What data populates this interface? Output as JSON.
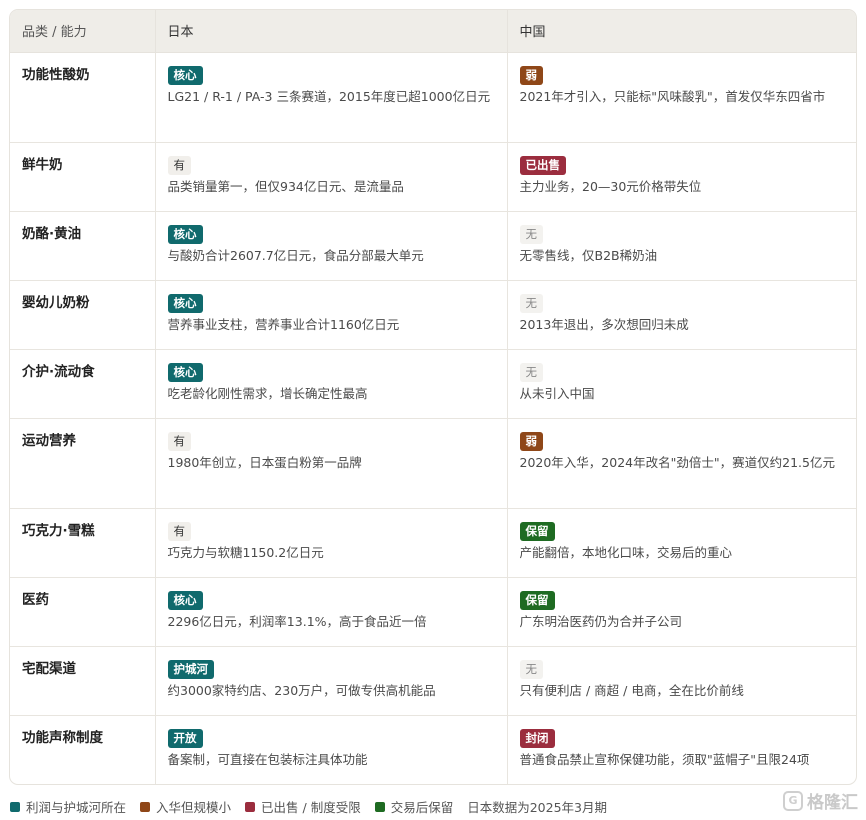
{
  "header": {
    "col1": "品类 / 能力",
    "col2": "日本",
    "col3": "中国"
  },
  "colors": {
    "teal": "#106a6d",
    "brown": "#8f4718",
    "red": "#9b2d3e",
    "green": "#1e6b22"
  },
  "rows": [
    {
      "category": "功能性酸奶",
      "jp": {
        "badge": "核心",
        "style": "teal",
        "text": "LG21 / R-1 / PA-3 三条赛道，2015年度已超1000亿日元"
      },
      "cn": {
        "badge": "弱",
        "style": "brown",
        "text": "2021年才引入，只能标\"风味酸乳\"，首发仅华东四省市"
      }
    },
    {
      "category": "鲜牛奶",
      "jp": {
        "badge": "有",
        "style": "plain",
        "text": "品类销量第一，但仅934亿日元、是流量品"
      },
      "cn": {
        "badge": "已出售",
        "style": "red",
        "text": "主力业务，20—30元价格带失位"
      }
    },
    {
      "category": "奶酪·黄油",
      "jp": {
        "badge": "核心",
        "style": "teal",
        "text": "与酸奶合计2607.7亿日元，食品分部最大单元"
      },
      "cn": {
        "badge": "无",
        "style": "none",
        "text": "无零售线，仅B2B稀奶油"
      }
    },
    {
      "category": "婴幼儿奶粉",
      "jp": {
        "badge": "核心",
        "style": "teal",
        "text": "营养事业支柱，营养事业合计1160亿日元"
      },
      "cn": {
        "badge": "无",
        "style": "none",
        "text": "2013年退出，多次想回归未成"
      }
    },
    {
      "category": "介护·流动食",
      "jp": {
        "badge": "核心",
        "style": "teal",
        "text": "吃老龄化刚性需求，增长确定性最高"
      },
      "cn": {
        "badge": "无",
        "style": "none",
        "text": "从未引入中国"
      }
    },
    {
      "category": "运动营养",
      "jp": {
        "badge": "有",
        "style": "plain",
        "text": "1980年创立，日本蛋白粉第一品牌"
      },
      "cn": {
        "badge": "弱",
        "style": "brown",
        "text": "2020年入华，2024年改名\"劲倍士\"，赛道仅约21.5亿元"
      }
    },
    {
      "category": "巧克力·雪糕",
      "jp": {
        "badge": "有",
        "style": "plain",
        "text": "巧克力与软糖1150.2亿日元"
      },
      "cn": {
        "badge": "保留",
        "style": "green",
        "text": "产能翻倍，本地化口味，交易后的重心"
      }
    },
    {
      "category": "医药",
      "jp": {
        "badge": "核心",
        "style": "teal",
        "text": "2296亿日元，利润率13.1%，高于食品近一倍"
      },
      "cn": {
        "badge": "保留",
        "style": "green",
        "text": "广东明治医药仍为合并子公司"
      }
    },
    {
      "category": "宅配渠道",
      "jp": {
        "badge": "护城河",
        "style": "teal",
        "text": "约3000家特约店、230万户，可做专供高机能品"
      },
      "cn": {
        "badge": "无",
        "style": "none",
        "text": "只有便利店 / 商超 / 电商，全在比价前线"
      }
    },
    {
      "category": "功能声称制度",
      "jp": {
        "badge": "开放",
        "style": "teal",
        "text": "备案制，可直接在包装标注具体功能"
      },
      "cn": {
        "badge": "封闭",
        "style": "red",
        "text": "普通食品禁止宣称保健功能，须取\"蓝帽子\"且限24项"
      }
    }
  ],
  "legend": {
    "items": [
      {
        "label": "利润与护城河所在",
        "style": "teal"
      },
      {
        "label": "入华但规模小",
        "style": "brown"
      },
      {
        "label": "已出售 / 制度受限",
        "style": "red"
      },
      {
        "label": "交易后保留",
        "style": "green"
      }
    ],
    "note": "日本数据为2025年3月期"
  },
  "watermark": {
    "text": "格隆汇",
    "icon": "gelonghui-logo-icon"
  }
}
